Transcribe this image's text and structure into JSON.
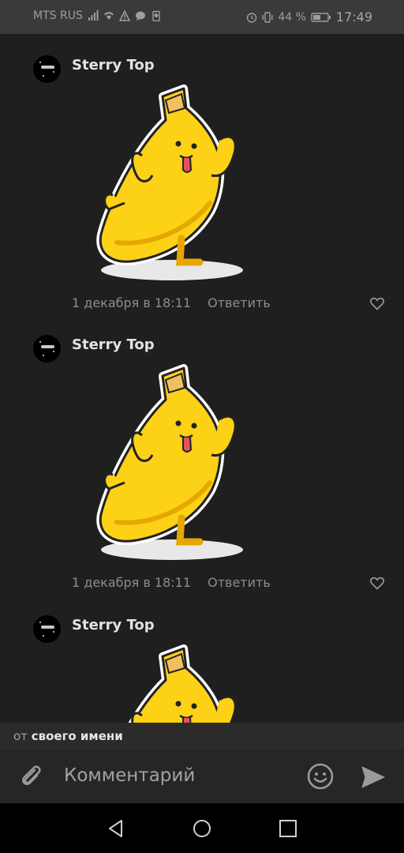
{
  "status_bar": {
    "carrier": "MTS RUS",
    "battery": "44 %",
    "time": "17:49",
    "icons": [
      "signal-icon",
      "wifi-icon",
      "warning-icon",
      "message-icon",
      "battery-saver-icon",
      "alarm-icon",
      "vibrate-icon",
      "battery-icon"
    ]
  },
  "comments": [
    {
      "author": "Sterry Top",
      "date": "1 декабря в 18:11",
      "reply_label": "Ответить",
      "sticker": "banana-sticker"
    },
    {
      "author": "Sterry Top",
      "date": "1 декабря в 18:11",
      "reply_label": "Ответить",
      "sticker": "banana-sticker"
    },
    {
      "author": "Sterry Top",
      "sticker": "banana-sticker"
    }
  ],
  "identity": {
    "prefix": "от",
    "name": "своего имени"
  },
  "composer": {
    "placeholder": "Комментарий",
    "icons": [
      "paperclip-icon",
      "emoji-icon",
      "send-icon"
    ]
  },
  "nav": {
    "icons": [
      "back-icon",
      "home-icon",
      "recents-icon"
    ]
  },
  "colors": {
    "background": "#1f1f1f",
    "status_bar": "#3a3a3a",
    "text": "#e1e3e6",
    "muted": "#8d8d8d",
    "banana": "#fcd116"
  }
}
